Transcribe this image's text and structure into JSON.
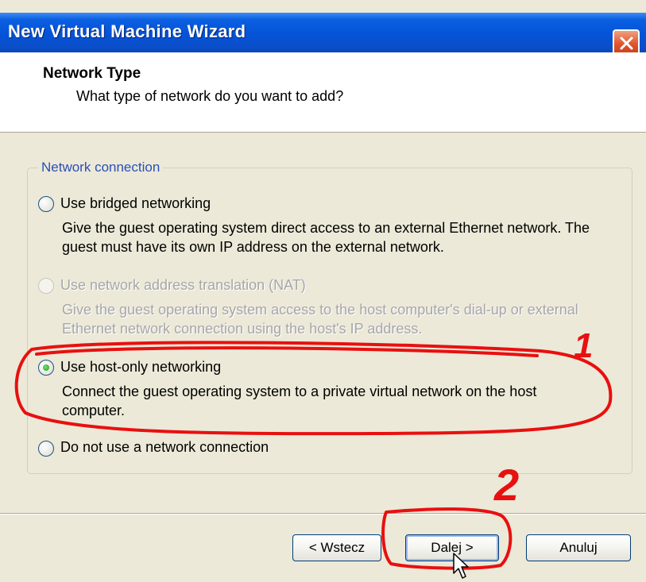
{
  "window": {
    "title": "New Virtual Machine Wizard"
  },
  "header": {
    "title": "Network Type",
    "subtitle": "What type of network do you want to add?"
  },
  "group": {
    "label": "Network connection",
    "options": [
      {
        "label": "Use bridged networking",
        "description": "Give the guest operating system direct access to an external Ethernet network. The guest must have its own IP address on the external network.",
        "selected": false,
        "enabled": true
      },
      {
        "label": "Use network address translation (NAT)",
        "description": "Give the guest operating system access to the host computer's dial-up or external Ethernet network connection using the host's IP address.",
        "selected": false,
        "enabled": false
      },
      {
        "label": "Use host-only networking",
        "description": "Connect the guest operating system to a private virtual network on the host computer.",
        "selected": true,
        "enabled": true
      },
      {
        "label": "Do not use a network connection",
        "selected": false,
        "enabled": true
      }
    ]
  },
  "buttons": {
    "back": "< Wstecz",
    "next": "Dalej >",
    "cancel": "Anuluj"
  },
  "annotations": {
    "mark_1": "1",
    "mark_2": "2",
    "color": "#e81010"
  },
  "colors": {
    "titlebar": "#0553d8",
    "dialog_bg": "#ece9d8",
    "group_label": "#2b4fb8",
    "close_button": "#e0542c"
  }
}
